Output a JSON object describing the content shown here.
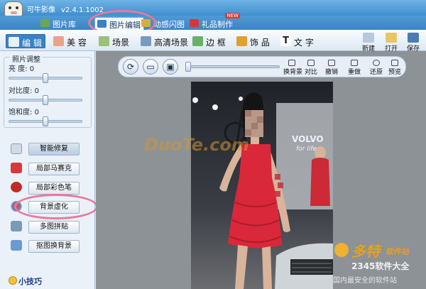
{
  "app": {
    "title": "可牛影像",
    "version": "v2.4.1.1002"
  },
  "tabs": [
    {
      "label": "图片库",
      "color": "#6aa84f"
    },
    {
      "label": "图片编辑",
      "color": "#3a82c4",
      "active": true
    },
    {
      "label": "动感闪图",
      "color": "#d4b040"
    },
    {
      "label": "礼品制作",
      "color": "#d03a3a",
      "badge": "NEW"
    }
  ],
  "toolbar": {
    "items": [
      {
        "label": "编 辑",
        "color": "#ffffff",
        "active": true
      },
      {
        "label": "美 容",
        "color": "#e8a38a"
      },
      {
        "label": "场景",
        "color": "#9ac07a"
      },
      {
        "label": "高清场景",
        "color": "#7a9ac0"
      },
      {
        "label": "边 框",
        "color": "#6ab06a"
      },
      {
        "label": "饰 品",
        "color": "#e0a030"
      },
      {
        "label": "文 字",
        "color": "#3a3a3a"
      }
    ],
    "right": [
      {
        "label": "新建",
        "color": "#b7c9dc"
      },
      {
        "label": "打开",
        "color": "#e9c56a"
      },
      {
        "label": "保存",
        "color": "#4a7db0"
      }
    ]
  },
  "sidebar": {
    "group_title": "照片调整",
    "sliders": [
      {
        "label": "亮  度:",
        "value": 0,
        "level": 0.5
      },
      {
        "label": "对比度:",
        "value": 0,
        "level": 0.5
      },
      {
        "label": "饱和度:",
        "value": 0,
        "level": 0.5
      }
    ],
    "tools": [
      {
        "label": "智能修复",
        "color": "#d0dbe6",
        "selected": true
      },
      {
        "label": "局部马赛克",
        "color": "#d63a3a"
      },
      {
        "label": "局部彩色笔",
        "color": "#c02a2a"
      },
      {
        "label": "背景虚化",
        "color": "#5a8ac8"
      },
      {
        "label": "多图拼贴",
        "color": "#7a9ab8"
      },
      {
        "label": "抠图换背景",
        "color": "#6a9ad0"
      }
    ],
    "tip_title": "小技巧"
  },
  "canvas_toolbar": {
    "zoom_level": 0.0,
    "buttons": [
      {
        "label": "换背景"
      },
      {
        "label": "对比"
      },
      {
        "label": "撤销"
      },
      {
        "label": "重做"
      },
      {
        "label": "还原"
      },
      {
        "label": "预览"
      }
    ]
  },
  "photo": {
    "sign_text": "VOLVO",
    "sign_sub": "for life",
    "watermark_center": "DuoTe.com",
    "watermark_brand": "多特",
    "watermark_brand2": "软件站",
    "watermark_footer": "国内最安全的软件站",
    "watermark_corner": "2345软件大全"
  },
  "colors": {
    "accent": "#3a82c4",
    "highlight_oval": "#e8789a",
    "dress": "#d8283a"
  }
}
